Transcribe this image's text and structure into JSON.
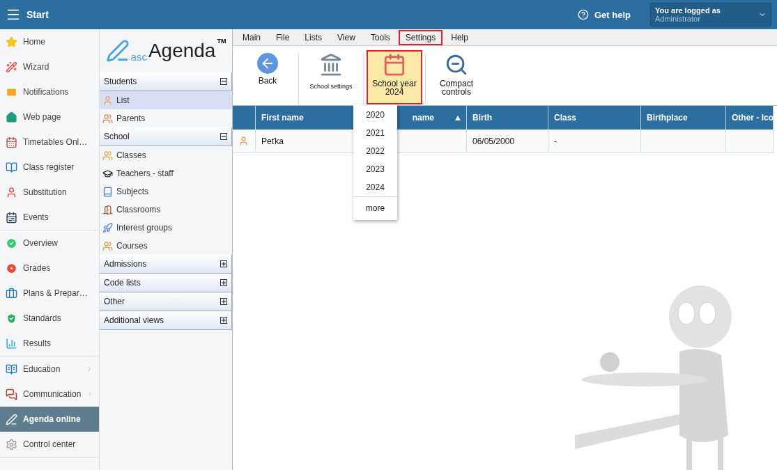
{
  "topbar": {
    "title": "Start",
    "help": "Get help",
    "user_label": "You are logged as",
    "user_name": "Administrator"
  },
  "nav": {
    "groups": [
      [
        {
          "label": "Home",
          "selected": false,
          "has_submenu": false
        },
        {
          "label": "Wizard",
          "selected": false,
          "has_submenu": false
        },
        {
          "label": "Notifications",
          "selected": false,
          "has_submenu": false
        },
        {
          "label": "Web page",
          "selected": false,
          "has_submenu": false
        },
        {
          "label": "Timetables Onl…",
          "selected": false,
          "has_submenu": false
        },
        {
          "label": "Class register",
          "selected": false,
          "has_submenu": false
        },
        {
          "label": "Substitution",
          "selected": false,
          "has_submenu": false
        },
        {
          "label": "Events",
          "selected": false,
          "has_submenu": false
        }
      ],
      [
        {
          "label": "Overview",
          "selected": false,
          "has_submenu": false
        },
        {
          "label": "Grades",
          "selected": false,
          "has_submenu": false
        },
        {
          "label": "Plans & Prepar…",
          "selected": false,
          "has_submenu": false
        },
        {
          "label": "Standards",
          "selected": false,
          "has_submenu": false
        },
        {
          "label": "Results",
          "selected": false,
          "has_submenu": false
        }
      ],
      [
        {
          "label": "Education",
          "selected": false,
          "has_submenu": true
        },
        {
          "label": "Communication",
          "selected": false,
          "has_submenu": true
        },
        {
          "label": "Agenda online",
          "selected": true,
          "has_submenu": false
        },
        {
          "label": "Control center",
          "selected": false,
          "has_submenu": false
        }
      ]
    ]
  },
  "logo": {
    "prefix": "asc",
    "name": "Agenda",
    "mark": "TM"
  },
  "sections": [
    {
      "title": "Students",
      "expanded": true,
      "items": [
        {
          "label": "List",
          "selected": true
        },
        {
          "label": "Parents",
          "selected": false
        }
      ]
    },
    {
      "title": "School",
      "expanded": true,
      "items": [
        {
          "label": "Classes",
          "selected": false
        },
        {
          "label": "Teachers - staff",
          "selected": false
        },
        {
          "label": "Subjects",
          "selected": false
        },
        {
          "label": "Classrooms",
          "selected": false
        },
        {
          "label": "Interest groups",
          "selected": false
        },
        {
          "label": "Courses",
          "selected": false
        }
      ]
    },
    {
      "title": "Admissions",
      "expanded": false
    },
    {
      "title": "Code lists",
      "expanded": false
    },
    {
      "title": "Other",
      "expanded": false
    },
    {
      "title": "Additional views",
      "expanded": false
    }
  ],
  "menu": [
    {
      "label": "Main",
      "highlighted": false
    },
    {
      "label": "File",
      "highlighted": false
    },
    {
      "label": "Lists",
      "highlighted": false
    },
    {
      "label": "View",
      "highlighted": false
    },
    {
      "label": "Tools",
      "highlighted": false
    },
    {
      "label": "Settings",
      "highlighted": true
    },
    {
      "label": "Help",
      "highlighted": false
    }
  ],
  "toolbar": [
    {
      "kind": "back",
      "label": "Back",
      "active": false,
      "highlighted": false
    },
    {
      "kind": "school",
      "label": "School settings",
      "active": false,
      "highlighted": false
    },
    {
      "kind": "year",
      "label": "School year",
      "value": "2024",
      "active": true,
      "highlighted": true
    },
    {
      "kind": "compact",
      "label": "Compact controls",
      "active": false,
      "highlighted": false
    }
  ],
  "year_menu": {
    "years": [
      "2020",
      "2021",
      "2022",
      "2023",
      "2024"
    ],
    "more": "more"
  },
  "table": {
    "columns": [
      {
        "label": "First name",
        "sorted": false
      },
      {
        "label": "name",
        "sorted": true
      },
      {
        "label": "Birth",
        "sorted": false
      },
      {
        "label": "Class",
        "sorted": false
      },
      {
        "label": "Birthplace",
        "sorted": false
      },
      {
        "label": "Other - Ico",
        "sorted": false
      }
    ],
    "rows": [
      [
        "Peťka",
        "",
        "06/05/2000",
        "-",
        "",
        ""
      ]
    ]
  }
}
